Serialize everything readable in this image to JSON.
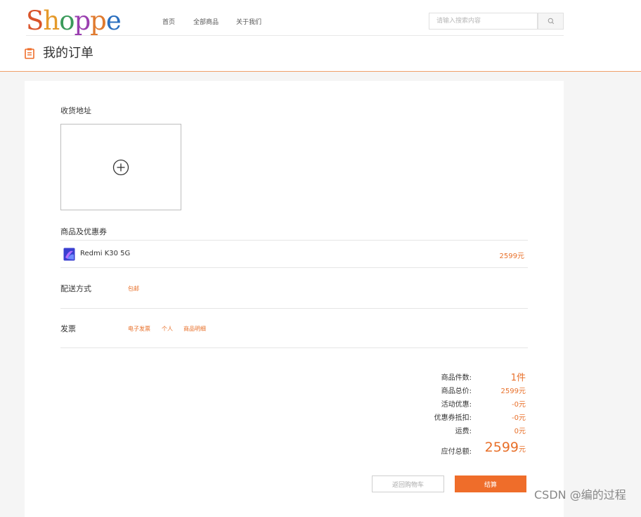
{
  "header": {
    "logo_letters": [
      "S",
      "h",
      "o",
      "p",
      "p",
      "e"
    ],
    "logo_colors": [
      "#d9542a",
      "#e59a2b",
      "#3a9a5a",
      "#9a3fb0",
      "#e07a2e",
      "#2a6fbf"
    ],
    "nav": [
      {
        "label": "首页"
      },
      {
        "label": "全部商品"
      },
      {
        "label": "关于我们"
      }
    ],
    "search_placeholder": "请输入搜索内容"
  },
  "page": {
    "title": "我的订单"
  },
  "order": {
    "address_section_label": "收货地址",
    "goods_section_label": "商品及优惠券",
    "product": {
      "name": "Redmi K30 5G",
      "price": "2599元"
    },
    "delivery": {
      "label": "配送方式",
      "value": "包邮"
    },
    "invoice": {
      "label": "发票",
      "options": [
        "电子发票",
        "个人",
        "商品明细"
      ]
    },
    "summary": {
      "item_count_label": "商品件数:",
      "item_count_value": "1件",
      "total_price_label": "商品总价:",
      "total_price_value": "2599元",
      "discount_label": "活动优惠:",
      "discount_value": "-0元",
      "coupon_label": "优惠券抵扣:",
      "coupon_value": "-0元",
      "shipping_label": "运费:",
      "shipping_value": "0元",
      "payable_label": "应付总额:",
      "payable_amount": "2599",
      "payable_unit": "元"
    },
    "back_button": "返回购物车",
    "checkout_button": "结算"
  },
  "watermark": "CSDN @编的过程",
  "colors": {
    "accent": "#ef6d2a",
    "price": "#e8702a"
  }
}
